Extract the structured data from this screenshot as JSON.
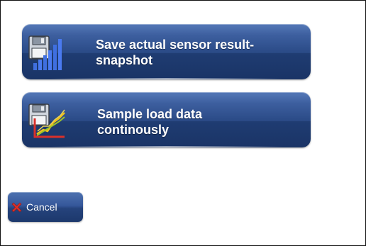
{
  "actions": [
    {
      "label": "Save actual sensor result-\nsnapshot",
      "icon": "save-signal-bars-icon"
    },
    {
      "label": "Sample load data\ncontinously",
      "icon": "save-line-chart-icon"
    }
  ],
  "cancel": {
    "label": "Cancel",
    "icon": "red-x-icon"
  },
  "colors": {
    "button_top": "#5579b8",
    "button_bottom": "#1a3466",
    "label_text": "#ffffff",
    "cancel_x": "#d9302b"
  }
}
